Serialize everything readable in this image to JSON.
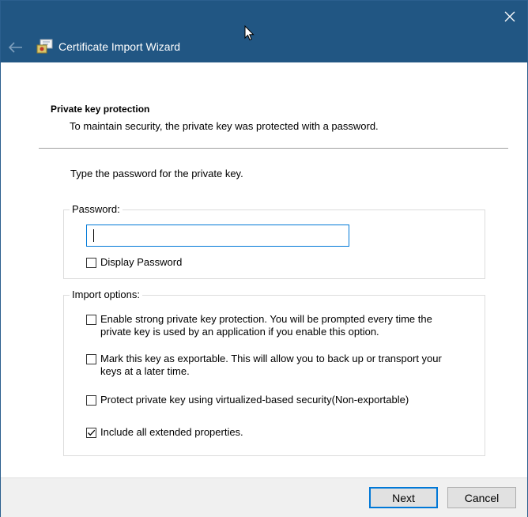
{
  "window": {
    "close_icon": "close-icon",
    "back_icon": "back-arrow-icon",
    "app_icon": "certificate-icon",
    "title": "Certificate Import Wizard"
  },
  "page": {
    "heading": "Private key protection",
    "description": "To maintain security, the private key was protected with a password.",
    "instruction": "Type the password for the private key."
  },
  "password_group": {
    "legend": "Password:",
    "input_value": "",
    "display_password_label": "Display Password",
    "display_password_checked": false
  },
  "import_group": {
    "legend": "Import options:",
    "options": [
      {
        "label": "Enable strong private key protection. You will be prompted every time the private key is used by an application if you enable this option.",
        "checked": false
      },
      {
        "label": "Mark this key as exportable. This will allow you to back up or transport your keys at a later time.",
        "checked": false
      },
      {
        "label": "Protect private key using virtualized-based security(Non-exportable)",
        "checked": false
      },
      {
        "label": "Include all extended properties.",
        "checked": true
      }
    ]
  },
  "footer": {
    "next_label": "Next",
    "cancel_label": "Cancel"
  },
  "colors": {
    "titlebar": "#215683",
    "focus_border": "#0078d7",
    "footer_bg": "#f0f0f0"
  }
}
